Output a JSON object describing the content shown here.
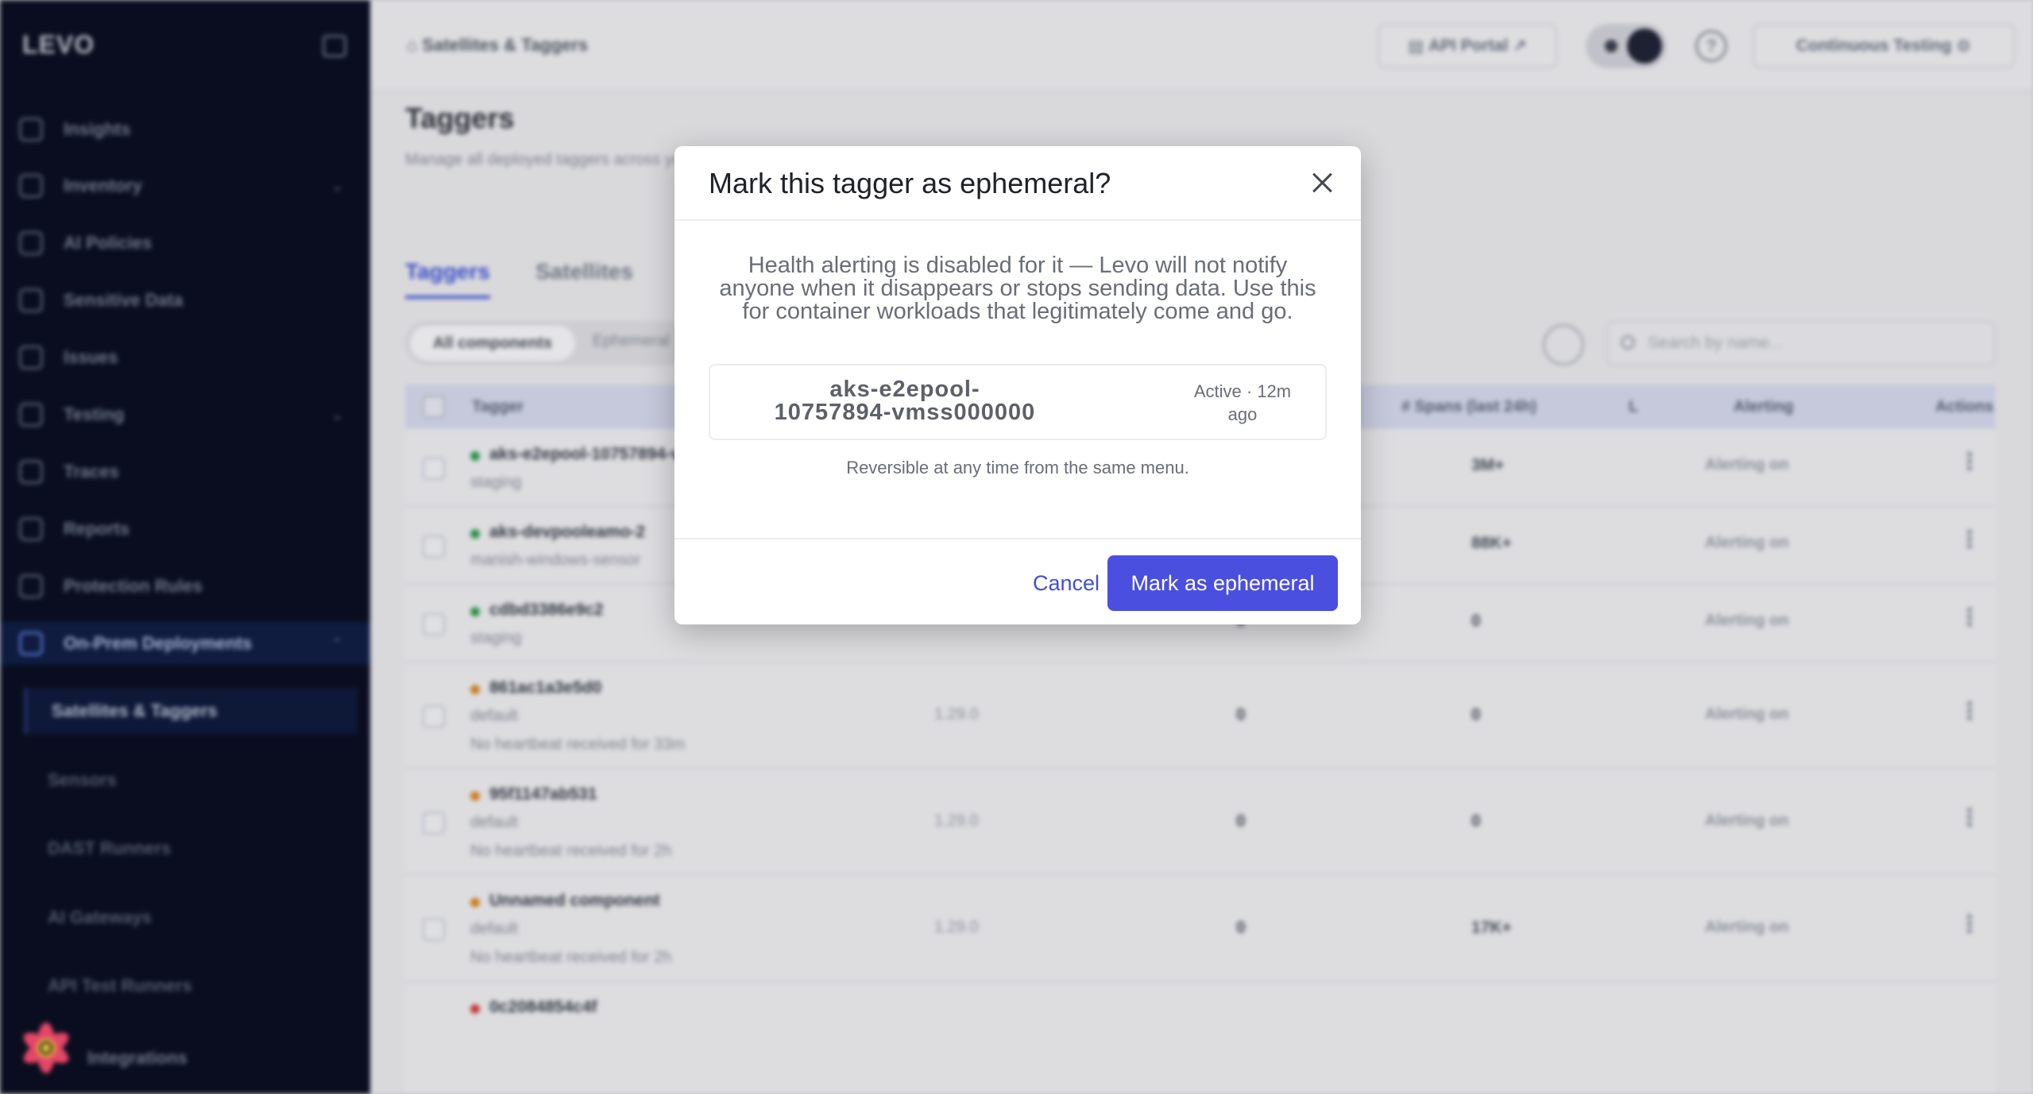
{
  "sidebar": {
    "logo": "LEVO",
    "items": [
      {
        "label": "Insights"
      },
      {
        "label": "Inventory"
      },
      {
        "label": "AI Policies"
      },
      {
        "label": "Sensitive Data"
      },
      {
        "label": "Issues"
      },
      {
        "label": "Testing"
      },
      {
        "label": "Traces"
      },
      {
        "label": "Reports"
      },
      {
        "label": "Protection Rules"
      },
      {
        "label": "On-Prem Deployments"
      }
    ],
    "sub_items": [
      {
        "label": "Satellites & Taggers"
      },
      {
        "label": "Sensors"
      },
      {
        "label": "DAST Runners"
      },
      {
        "label": "AI Gateways"
      },
      {
        "label": "API Test Runners"
      }
    ],
    "integrations_label": "Integrations"
  },
  "topbar": {
    "breadcrumb": "Satellites & Taggers",
    "api_portal_label": "API Portal",
    "env_label": "Continuous Testing"
  },
  "page": {
    "title": "Taggers",
    "subtitle": "Manage all deployed taggers across your environments",
    "tabs": [
      {
        "label": "Taggers"
      },
      {
        "label": "Satellites"
      }
    ],
    "filter_all": "All components",
    "filter_other": "Ephemeral",
    "search_placeholder": "Search by name..."
  },
  "table": {
    "headers": {
      "tagger": "Tagger",
      "spans": "# Spans (last 24h)",
      "l": "L",
      "alerting": "Alerting",
      "actions": "Actions"
    },
    "rows": [
      {
        "name": "aks-e2epool-10757894-vmss000000",
        "env": "staging",
        "note": "",
        "version": "",
        "n1": "",
        "n2": "3M+",
        "alerting": "Alerting on",
        "status_color": "#2e9e4a"
      },
      {
        "name": "aks-devpooleamo-2",
        "env": "manish-windows-sensor",
        "note": "",
        "version": "",
        "n1": "",
        "n2": "88K+",
        "alerting": "Alerting on",
        "status_color": "#2e9e4a"
      },
      {
        "name": "cdbd3386e9c2",
        "env": "staging",
        "note": "",
        "version": "",
        "n1": "0",
        "n2": "0",
        "alerting": "Alerting on",
        "status_color": "#2e9e4a"
      },
      {
        "name": "861ac1a3e5d0",
        "env": "default",
        "note": "No heartbeat received for 33m",
        "version": "1.29.0",
        "n1": "0",
        "n2": "0",
        "alerting": "Alerting on",
        "status_color": "#e08a1e"
      },
      {
        "name": "95f1147ab531",
        "env": "default",
        "note": "No heartbeat received for 2h",
        "version": "1.29.0",
        "n1": "0",
        "n2": "0",
        "alerting": "Alerting on",
        "status_color": "#e08a1e"
      },
      {
        "name": "Unnamed component",
        "env": "default",
        "note": "No heartbeat received for 2h",
        "version": "1.29.0",
        "n1": "0",
        "n2": "17K+",
        "alerting": "Alerting on",
        "status_color": "#e08a1e"
      },
      {
        "name": "0c2084854c4f",
        "env": "",
        "note": "",
        "version": "",
        "n1": "",
        "n2": "",
        "alerting": "",
        "status_color": "#d93a3a"
      }
    ]
  },
  "modal": {
    "title": "Mark this tagger as ephemeral?",
    "description": "Health alerting is disabled for it — Levo will not notify anyone when it disappears or stops sending data. Use this for container workloads that legitimately come and go.",
    "tagger_name": "aks-e2epool-10757894-vmss000000",
    "tagger_status": "Active · 12m ago",
    "reversible_note": "Reversible at any time from the same menu.",
    "cancel_label": "Cancel",
    "confirm_label": "Mark as ephemeral"
  },
  "colors": {
    "accent": "#4a4fe0",
    "sidebar_bg": "#050a1c",
    "link": "#3f4fd9"
  }
}
